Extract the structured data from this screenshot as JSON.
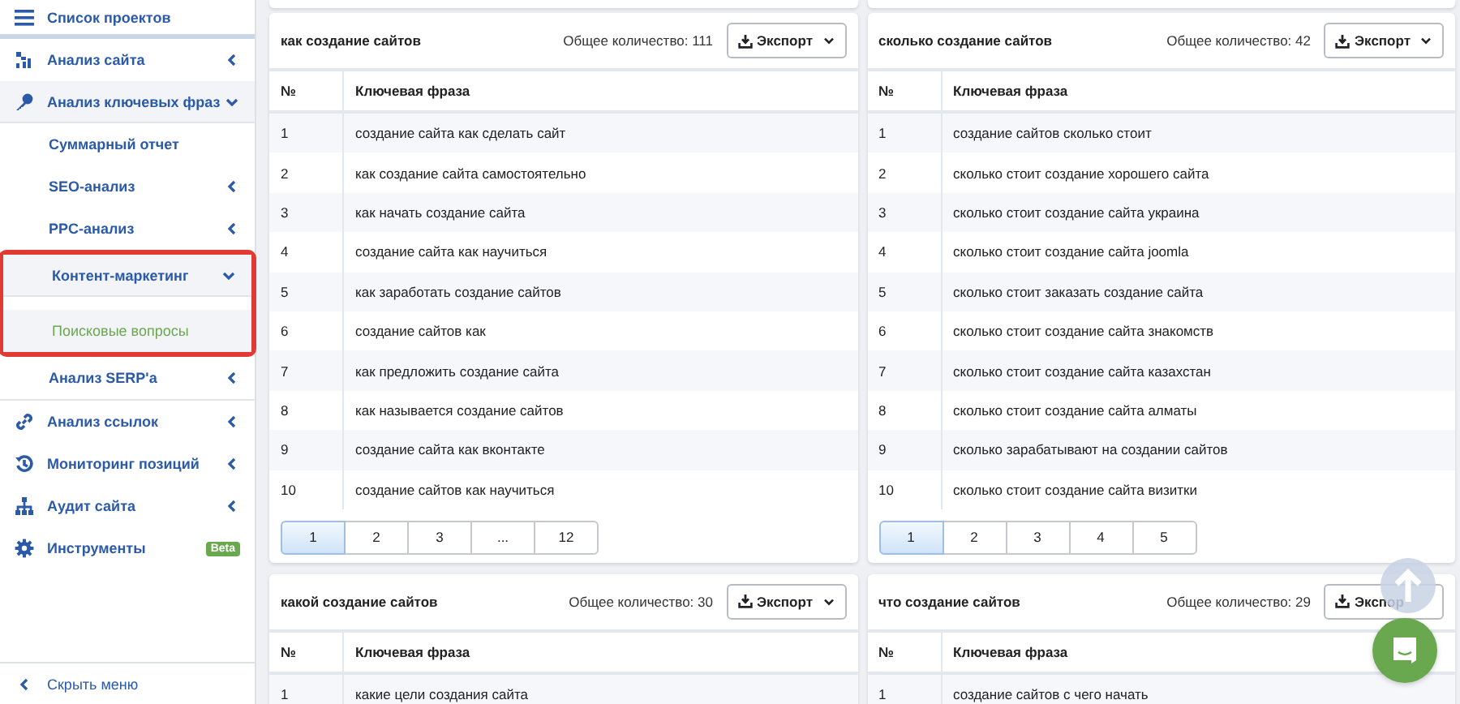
{
  "sidebar": {
    "header": "Список проектов",
    "items": [
      {
        "label": "Анализ сайта",
        "expanded": false,
        "selected": false
      },
      {
        "label": "Анализ ключевых фраз",
        "expanded": true,
        "selected": false,
        "children": [
          {
            "label": "Суммарный отчет",
            "selected": false,
            "highlighted": false
          },
          {
            "label": "SEO-анализ",
            "expanded": false,
            "selected": false,
            "highlighted": false
          },
          {
            "label": "PPC-анализ",
            "expanded": false,
            "selected": false,
            "highlighted": false
          },
          {
            "label": "Контент-маркетинг",
            "expanded": true,
            "selected": false,
            "highlighted": true,
            "children": [
              {
                "label": "Поисковые вопросы",
                "selected": true
              }
            ]
          },
          {
            "label": "Анализ SERP'a",
            "expanded": false,
            "selected": false,
            "highlighted": false
          }
        ]
      },
      {
        "label": "Анализ ссылок",
        "expanded": false,
        "selected": false
      },
      {
        "label": "Мониторинг позиций",
        "expanded": false,
        "selected": false
      },
      {
        "label": "Аудит сайта",
        "expanded": false,
        "selected": false
      },
      {
        "label": "Инструменты",
        "selected": false,
        "badge": "Beta"
      }
    ],
    "hide_menu": "Скрыть меню"
  },
  "panels": [
    {
      "title": "как создание сайтов",
      "total": "Общее количество: 111",
      "export": "Экспорт",
      "export_caret": true,
      "columns": [
        "№",
        "Ключевая фраза"
      ],
      "rows": [
        [
          "1",
          "создание сайта как сделать сайт"
        ],
        [
          "2",
          "как создание сайта самостоятельно"
        ],
        [
          "3",
          "как начать создание сайта"
        ],
        [
          "4",
          "создание сайта как научиться"
        ],
        [
          "5",
          "как заработать создание сайтов"
        ],
        [
          "6",
          "создание сайтов как"
        ],
        [
          "7",
          "как предложить создание сайта"
        ],
        [
          "8",
          "как называется создание сайтов"
        ],
        [
          "9",
          "создание сайта как вконтакте"
        ],
        [
          "10",
          "создание сайтов как научиться"
        ]
      ],
      "pagination": [
        {
          "label": "1",
          "selected": true
        },
        {
          "label": "2",
          "selected": false
        },
        {
          "label": "3",
          "selected": false
        },
        {
          "label": "...",
          "selected": false
        },
        {
          "label": "12",
          "selected": false
        }
      ]
    },
    {
      "title": "сколько создание сайтов",
      "total": "Общее количество: 42",
      "export": "Экспорт",
      "export_caret": true,
      "columns": [
        "№",
        "Ключевая фраза"
      ],
      "rows": [
        [
          "1",
          "создание сайтов сколько стоит"
        ],
        [
          "2",
          "сколько стоит создание хорошего сайта"
        ],
        [
          "3",
          "сколько стоит создание сайта украина"
        ],
        [
          "4",
          "сколько стоит создание сайта joomla"
        ],
        [
          "5",
          "сколько стоит заказать создание сайта"
        ],
        [
          "6",
          "сколько стоит создание сайта знакомств"
        ],
        [
          "7",
          "сколько стоит создание сайта казахстан"
        ],
        [
          "8",
          "сколько стоит создание сайта алматы"
        ],
        [
          "9",
          "сколько зарабатывают на создании сайтов"
        ],
        [
          "10",
          "сколько стоит создание сайта визитки"
        ]
      ],
      "pagination": [
        {
          "label": "1",
          "selected": true
        },
        {
          "label": "2",
          "selected": false
        },
        {
          "label": "3",
          "selected": false
        },
        {
          "label": "4",
          "selected": false
        },
        {
          "label": "5",
          "selected": false
        }
      ]
    },
    {
      "title": "какой создание сайтов",
      "total": "Общее количество: 30",
      "export": "Экспорт",
      "export_caret": true,
      "columns": [
        "№",
        "Ключевая фраза"
      ],
      "rows": [
        [
          "1",
          "какие цели создания сайта"
        ]
      ]
    },
    {
      "title": "что создание сайтов",
      "total": "Общее количество: 29",
      "export": "Экспор",
      "export_caret": false,
      "columns": [
        "№",
        "Ключевая фраза"
      ],
      "rows": [
        [
          "1",
          "создание сайтов с чего начать"
        ]
      ]
    }
  ]
}
